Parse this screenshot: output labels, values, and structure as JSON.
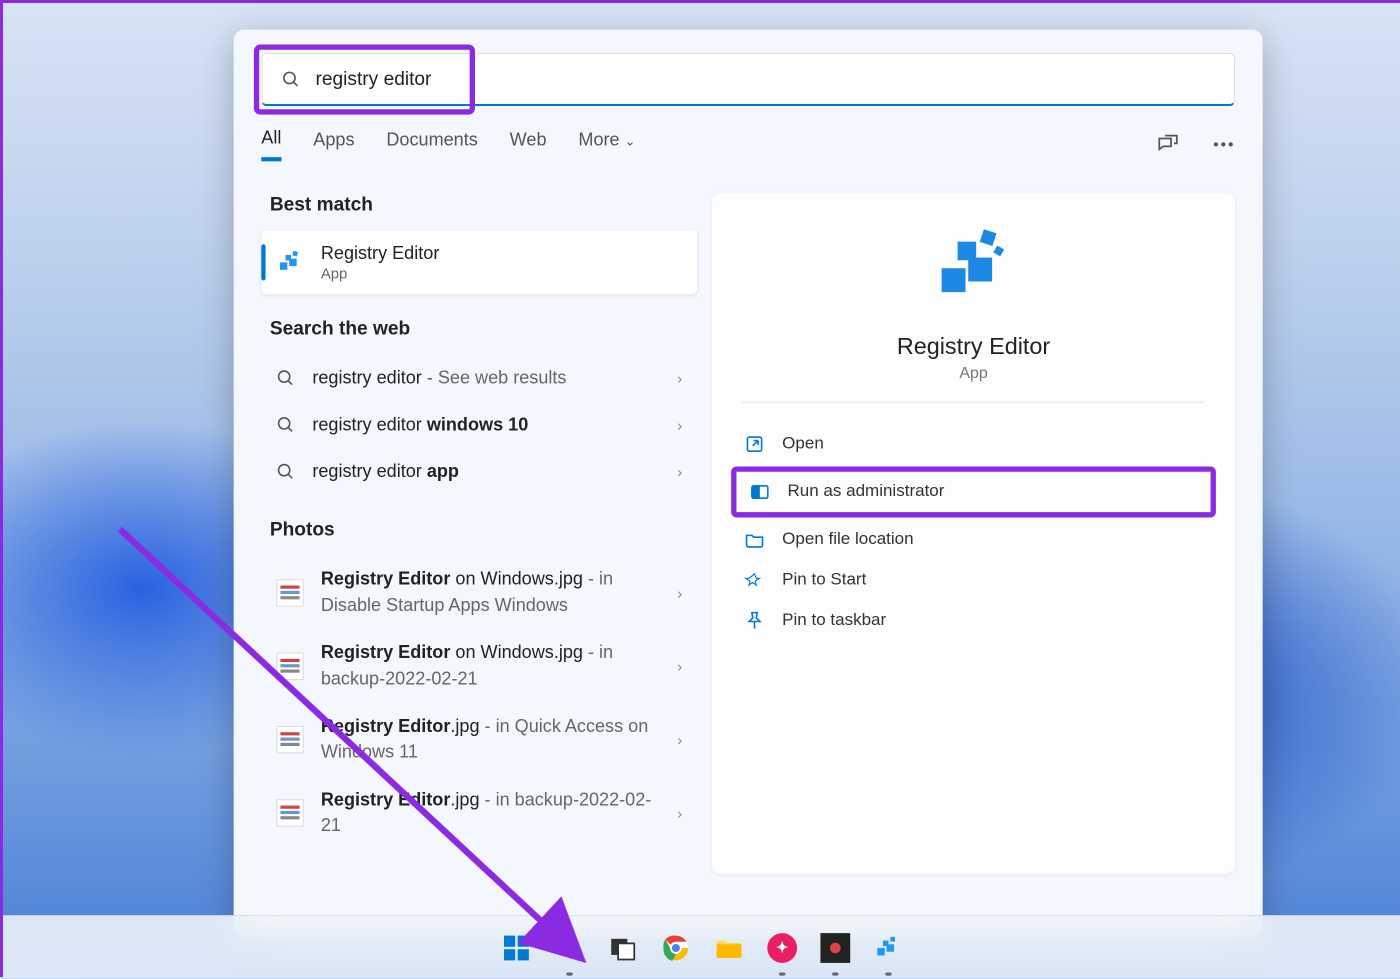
{
  "search": {
    "query": "registry editor"
  },
  "tabs": {
    "all": "All",
    "apps": "Apps",
    "documents": "Documents",
    "web": "Web",
    "more": "More"
  },
  "sections": {
    "best_match": "Best match",
    "search_web": "Search the web",
    "photos": "Photos"
  },
  "best_match": {
    "title": "Registry Editor",
    "subtitle": "App"
  },
  "web_results": [
    {
      "prefix": "registry editor",
      "suffix": " - See web results",
      "boldSuffix": ""
    },
    {
      "prefix": "registry editor ",
      "suffix": "",
      "boldSuffix": "windows 10"
    },
    {
      "prefix": "registry editor ",
      "suffix": "",
      "boldSuffix": "app"
    }
  ],
  "photos": [
    {
      "titleBold": "Registry Editor",
      "titleRest": " on Windows.jpg",
      "sub": " - in Disable Startup Apps Windows"
    },
    {
      "titleBold": "Registry Editor",
      "titleRest": " on Windows.jpg",
      "sub": " - in backup-2022-02-21"
    },
    {
      "titleBold": "Registry Editor",
      "titleRest": ".jpg",
      "sub": " - in Quick Access on Windows 11"
    },
    {
      "titleBold": "Registry Editor",
      "titleRest": ".jpg",
      "sub": " - in backup-2022-02-21"
    }
  ],
  "detail": {
    "name": "Registry Editor",
    "kind": "App",
    "actions": {
      "open": "Open",
      "run_admin": "Run as administrator",
      "open_location": "Open file location",
      "pin_start": "Pin to Start",
      "pin_taskbar": "Pin to taskbar"
    }
  }
}
